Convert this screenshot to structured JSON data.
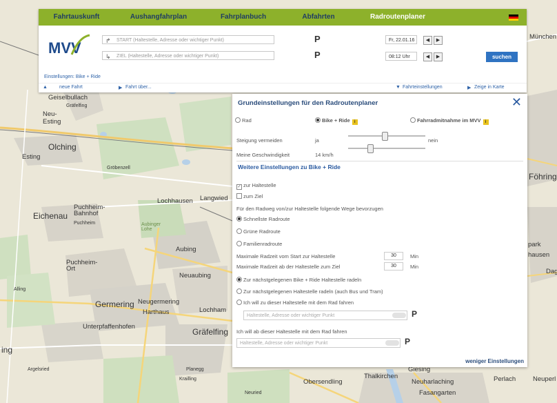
{
  "tabs": [
    "Fahrtauskunft",
    "Aushangfahrplan",
    "Fahrplanbuch",
    "Abfahrten",
    "Radroutenplaner"
  ],
  "active_tab": "Radroutenplaner",
  "logo_text": "MVV",
  "start_placeholder": "START (Haltestelle, Adresse oder wichtiger Punkt)",
  "ziel_placeholder": "ZIEL (Haltestelle, Adresse oder wichtiger Punkt)",
  "date_value": "Fr, 22.01.16",
  "time_value": "08:12 Uhr",
  "search_label": "suchen",
  "settings_summary": "Einstellungen: Bike + Ride",
  "nav": {
    "new_trip": "neue Fahrt",
    "trip_via": "Fahrt über...",
    "trip_settings": "Fahrteinstellungen",
    "show_map": "Zeige in Karte"
  },
  "settings": {
    "title": "Grundeinstellungen für den Radroutenplaner",
    "modes": [
      "Rad",
      "Bike + Ride",
      "Fahrradmitnahme im MVV"
    ],
    "selected_mode": "Bike + Ride",
    "avoid_slope_label": "Steigung vermeiden",
    "slope_yes": "ja",
    "slope_no": "nein",
    "speed_label": "Meine Geschwindigkeit",
    "speed_value": "14 km/h",
    "further_title": "Weitere Einstellungen zu Bike + Ride",
    "to_stop": "zur Haltestelle",
    "to_dest": "zum Ziel",
    "prefer_text": "Für den Radweg von/zur Haltestelle folgende Wege bevorzugen",
    "route_options": [
      "Schnellste Radroute",
      "Grüne Radroute",
      "Familienradroute"
    ],
    "selected_route": "Schnellste Radroute",
    "max_time_start_label": "Maximale Radzeit vom Start zur Haltestelle",
    "max_time_start_value": "30",
    "max_time_dest_label": "Maximale Radzeit ab der Haltestelle zum Ziel",
    "max_time_dest_value": "30",
    "unit": "Min",
    "stop_options": [
      "Zur nächstgelegenen Bike + Ride Haltestelle radeln",
      "Zur nächstgelegenen Haltestelle radeln (auch Bus und Tram)",
      "Ich will zu dieser Haltestelle mit dem Rad fahren"
    ],
    "stop_field_placeholder": "Haltestelle, Adresse oder wichtiger Punkt",
    "from_stop_label": "Ich will ab dieser Haltestelle mit dem Rad fahren",
    "from_stop_placeholder": "Haltestelle, Adresse oder wichtiger Punkt",
    "less_settings": "weniger Einstellungen"
  },
  "places": [
    "Geiselbullach",
    "Gräfelfing",
    "Neu-Esting",
    "Olching",
    "Esting",
    "Gröbenzell",
    "Eichenau",
    "Puchheim-Bahnhof",
    "Puchheim",
    "Lochhausen",
    "Langwied",
    "Aubinger Lohe",
    "Aubing",
    "Puchheim-Ort",
    "Neuaubing",
    "Germering",
    "Neugermering",
    "Harthaus",
    "Lochham",
    "Unterpfaffenhofen",
    "Gräfelfing",
    "Planegg",
    "Krailling",
    "Neuried",
    "Obersendling",
    "Thalkirchen",
    "Giesing",
    "Neuharlaching",
    "Perlach",
    "Fasangarten",
    "Föhring",
    "Neuperl",
    "Unterhaching",
    "München",
    "park",
    "hausen",
    "Dag",
    "Alling",
    "Argelsried",
    "ing"
  ],
  "colors": {
    "tab_bar": "#8db12b",
    "search_button": "#2f73c2",
    "link": "#2f63a8"
  }
}
